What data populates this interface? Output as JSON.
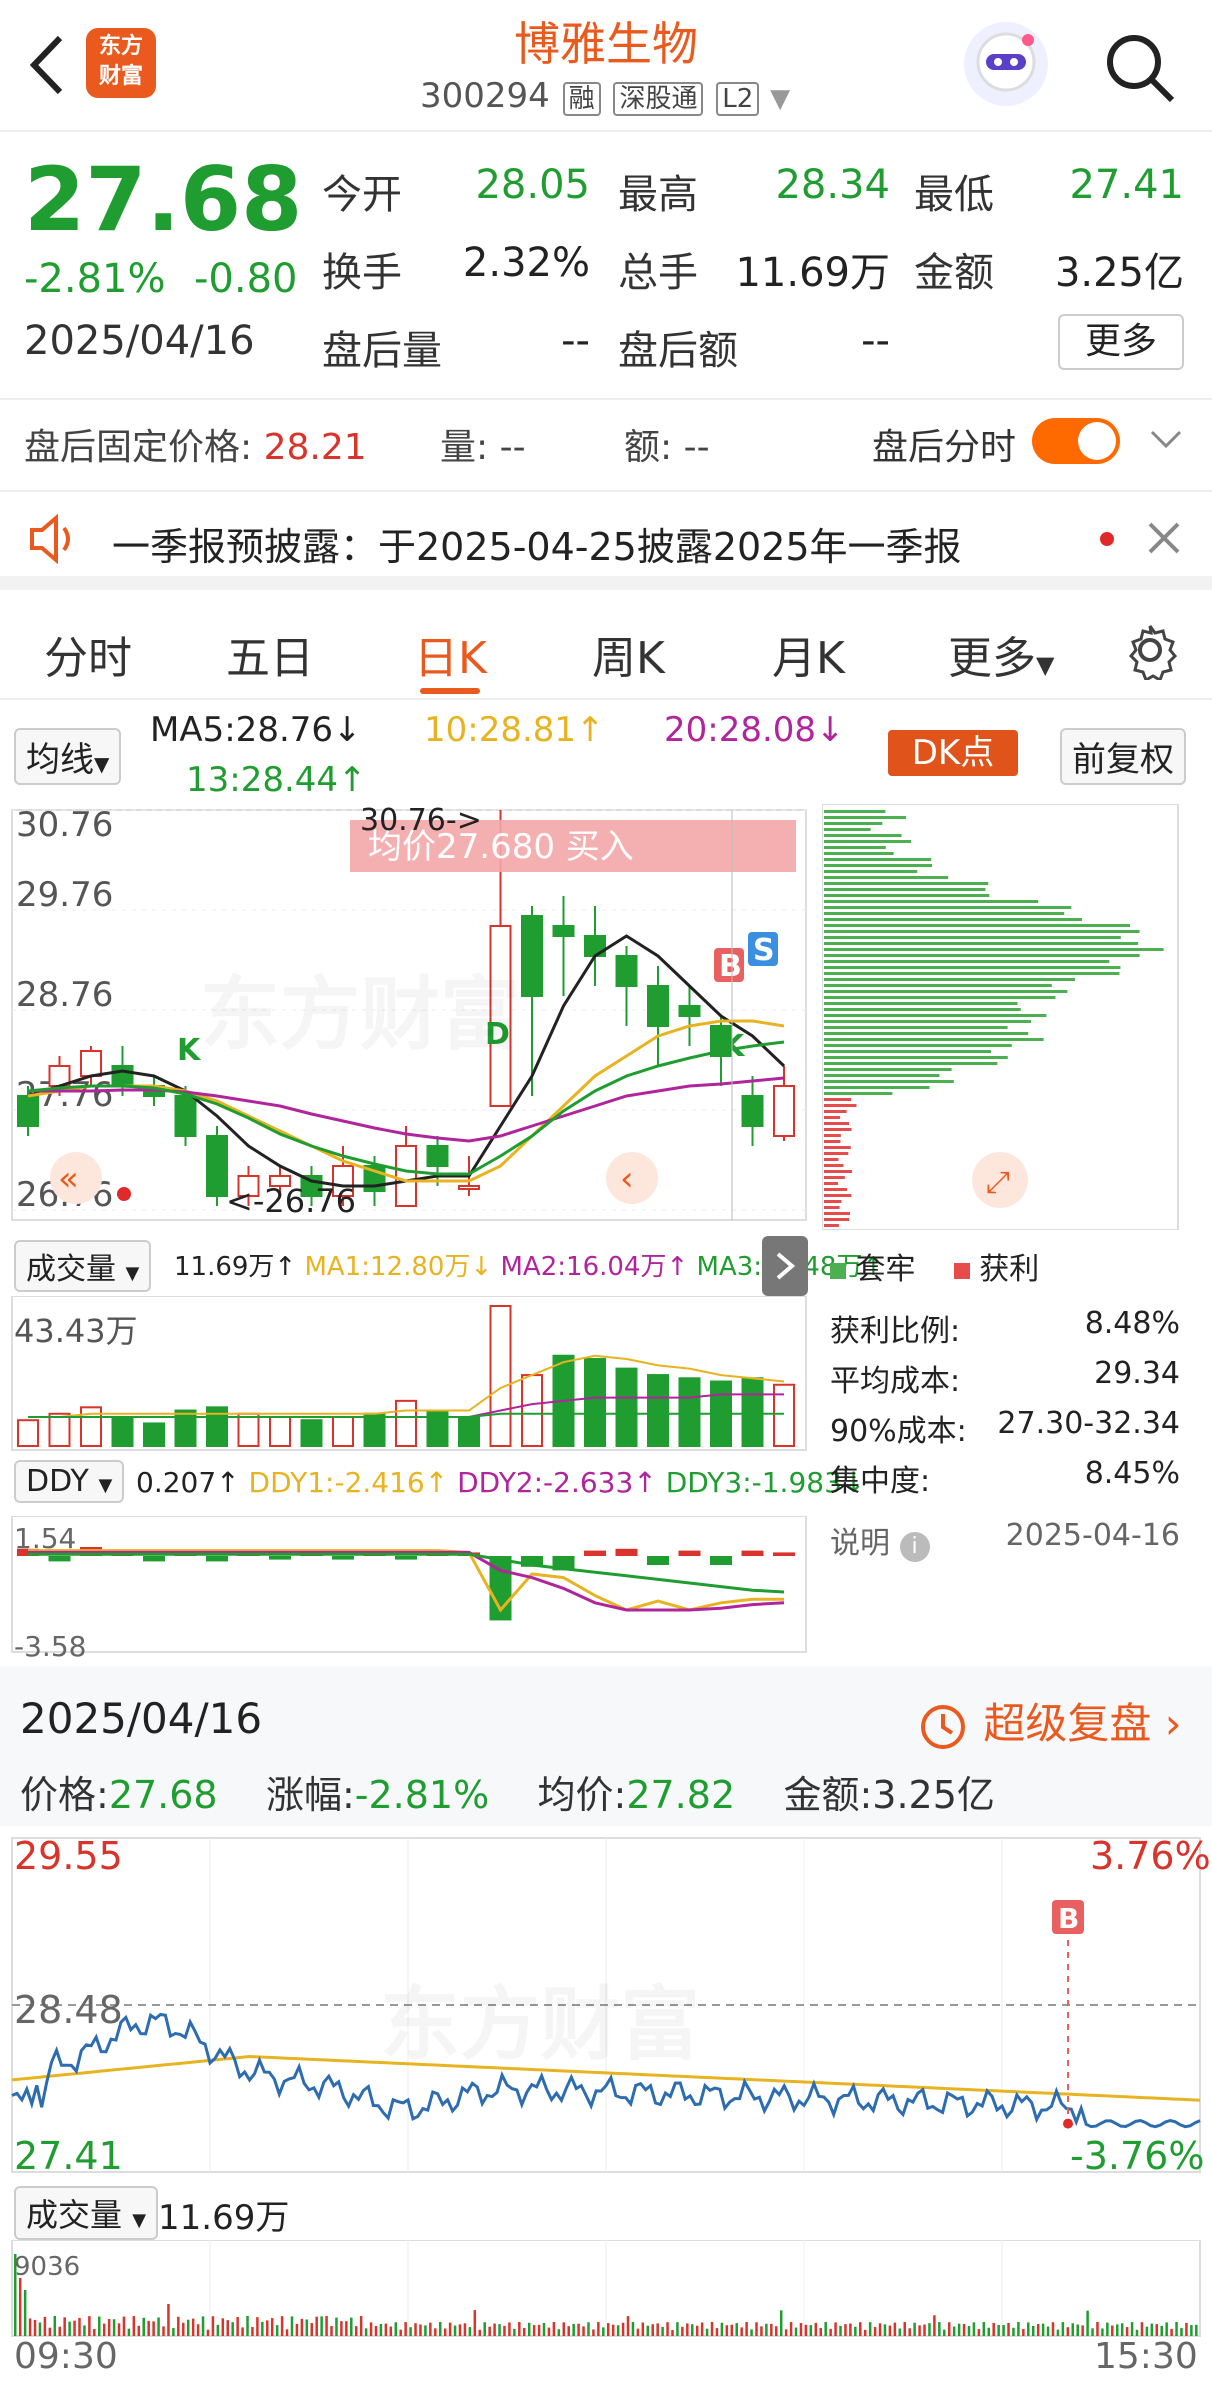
{
  "header": {
    "back_icon": "back-arrow-icon",
    "logo_text_1": "东方",
    "logo_text_2": "财富",
    "stock_name": "博雅生物",
    "stock_code": "300294",
    "tags": [
      "融",
      "深股通",
      "L2"
    ],
    "search_icon": "search-icon",
    "avatar_icon": "robot-avatar-icon"
  },
  "quote": {
    "price": "27.68",
    "change_pct": "-2.81%",
    "change": "-0.80",
    "date": "2025/04/16",
    "open_label": "今开",
    "open": "28.05",
    "high_label": "最高",
    "high": "28.34",
    "low_label": "最低",
    "low": "27.41",
    "turnover_label": "换手",
    "turnover": "2.32%",
    "volume_label": "总手",
    "volume": "11.69万",
    "amount_label": "金额",
    "amount": "3.25亿",
    "after_vol_label": "盘后量",
    "after_vol": "--",
    "after_amt_label": "盘后额",
    "after_amt": "--",
    "more_button": "更多"
  },
  "after_hours": {
    "fixed_price_label": "盘后固定价格:",
    "fixed_price": "28.21",
    "vol_label": "量:",
    "vol": "--",
    "amt_label": "额:",
    "amt": "--",
    "timeshare_label": "盘后分时"
  },
  "notice": {
    "text": "一季报预披露：于2025-04-25披露2025年一季报"
  },
  "tabs": [
    "分时",
    "五日",
    "日K",
    "周K",
    "月K",
    "更多"
  ],
  "kline": {
    "ma_selector": "均线",
    "ma5": "MA5:28.76↓",
    "ma10": "10:28.81↑",
    "ma20": "20:28.08↓",
    "ma13": "13:28.44↑",
    "dk_button": "DK点",
    "adjust_button": "前复权",
    "y_labels": [
      "30.76",
      "29.76",
      "28.76",
      "27.76",
      "26.76"
    ],
    "high_mark": "30.76->",
    "low_mark": "<-26.76",
    "avg_banner": "均价27.680  买入",
    "signals": [
      "B",
      "S",
      "K",
      "K",
      "D"
    ],
    "colors": {
      "up": "#d8342b",
      "down": "#1f9d30",
      "ma5": "#222222",
      "ma10": "#e8b320",
      "ma20": "#b0259c",
      "ma13": "#1f9d30"
    }
  },
  "volume_panel": {
    "selector": "成交量",
    "current": "11.69万↑",
    "ma1": "MA1:12.80万↓",
    "ma2": "MA2:16.04万↑",
    "ma3": "MA3:10.48万↑",
    "max_label": "43.43万"
  },
  "ddy_panel": {
    "selector": "DDY",
    "current": "0.207↑",
    "ddy1": "DDY1:-2.416↑",
    "ddy2": "DDY2:-2.633↑",
    "ddy3": "DDY3:-1.983↓",
    "top_label": "1.54",
    "bottom_label": "-3.58"
  },
  "chip_panel": {
    "legend_trapped": "套牢",
    "legend_profit": "获利",
    "rows": [
      {
        "label": "获利比例:",
        "value": "8.48%"
      },
      {
        "label": "平均成本:",
        "value": "29.34"
      },
      {
        "label": "90%成本:",
        "value": "27.30-32.34"
      },
      {
        "label": "集中度:",
        "value": "8.45%"
      }
    ],
    "note_label": "说明",
    "note_date": "2025-04-16"
  },
  "review": {
    "date": "2025/04/16",
    "super_review": "超级复盘",
    "price_label": "价格:",
    "price": "27.68",
    "change_label": "涨幅:",
    "change": "-2.81%",
    "avg_label": "均价:",
    "avg": "27.82",
    "amount_label": "金额:",
    "amount": "3.25亿"
  },
  "intraday": {
    "y_top": "29.55",
    "y_mid": "28.48",
    "y_bottom": "27.41",
    "pct_top": "3.76%",
    "pct_bottom": "-3.76%",
    "volume_selector": "成交量",
    "volume_value": "11.69万",
    "vol_max": "9036",
    "time_start": "09:30",
    "time_end": "15:30",
    "signal": "B"
  },
  "watermark": "东方财富"
}
